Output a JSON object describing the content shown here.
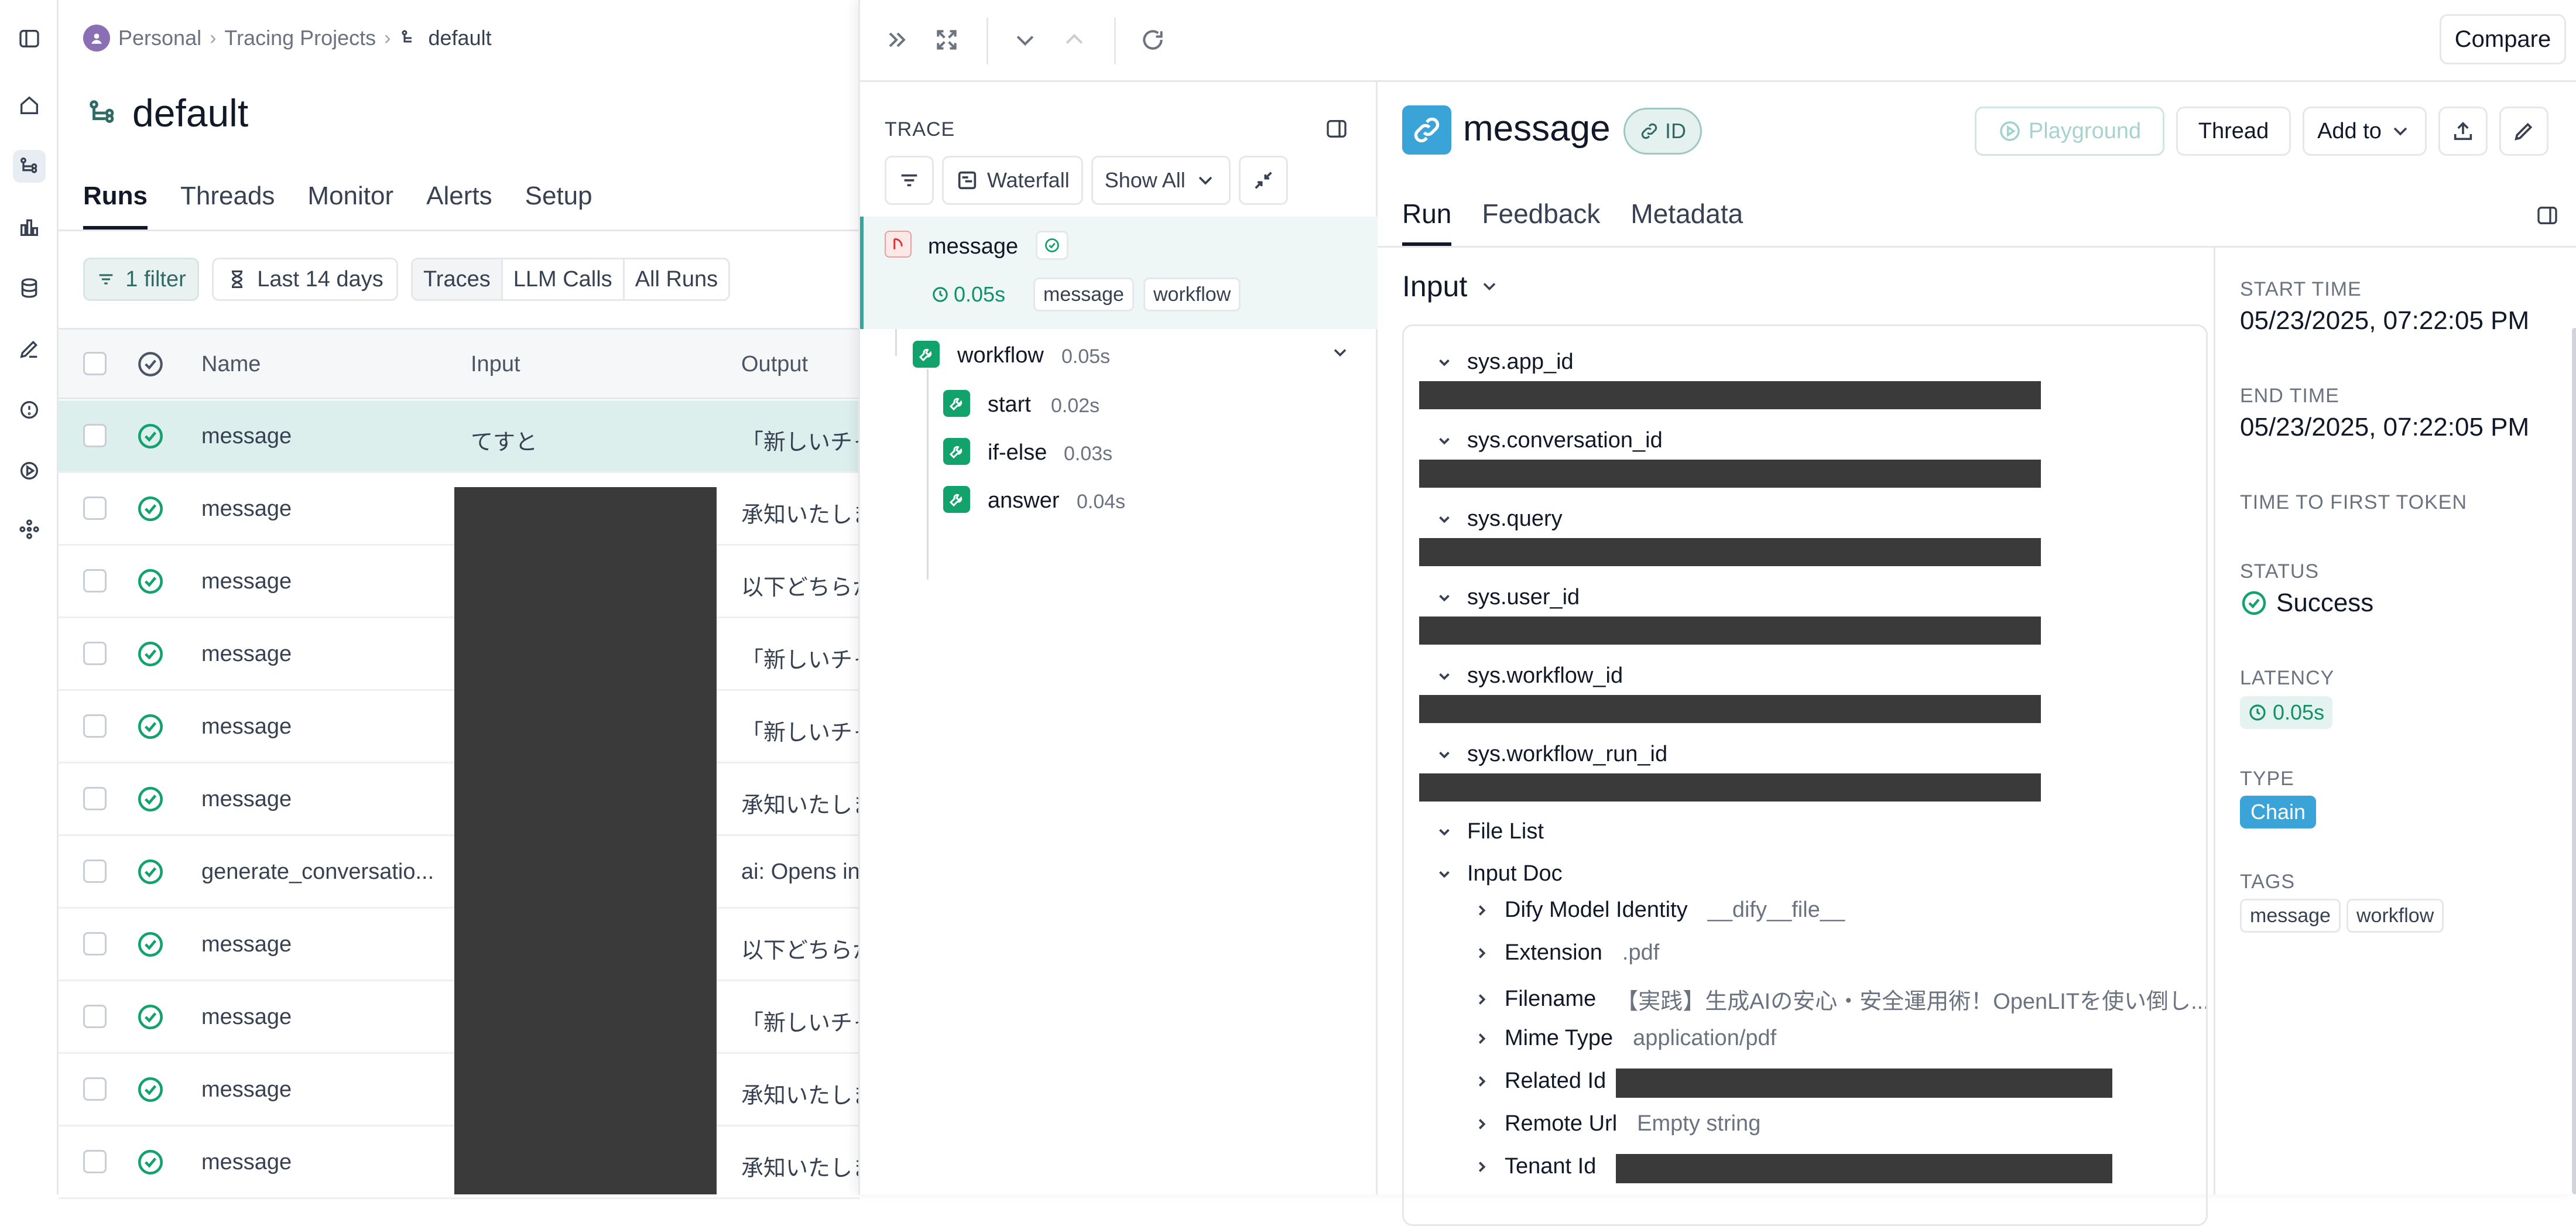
{
  "colors": {
    "accent": "#3aa39a",
    "success": "#12a36c",
    "chain": "#3aa3d8"
  },
  "breadcrumb": [
    "Personal",
    "Tracing Projects",
    "default"
  ],
  "project": {
    "title": "default"
  },
  "tabs": [
    "Runs",
    "Threads",
    "Monitor",
    "Alerts",
    "Setup"
  ],
  "filters": {
    "filter": "1 filter",
    "range": "Last 14 days",
    "types": [
      "Traces",
      "LLM Calls",
      "All Runs"
    ]
  },
  "table": {
    "headers": {
      "name": "Name",
      "input": "Input",
      "output": "Output"
    },
    "rows": [
      {
        "name": "message",
        "input": "てすと",
        "output": "「新しいチャ"
      },
      {
        "name": "message",
        "input": "",
        "output": "承知いたしま"
      },
      {
        "name": "message",
        "input": "",
        "output": "以下どちらか"
      },
      {
        "name": "message",
        "input": "",
        "output": "「新しいチャ"
      },
      {
        "name": "message",
        "input": "",
        "output": "「新しいチャ"
      },
      {
        "name": "message",
        "input": "",
        "output": "承知いたしま"
      },
      {
        "name": "generate_conversatio...",
        "input": "",
        "output": "ai: Opens in"
      },
      {
        "name": "message",
        "input": "",
        "output": "以下どちらか"
      },
      {
        "name": "message",
        "input": "",
        "output": "「新しいチャ"
      },
      {
        "name": "message",
        "input": "",
        "output": "承知いたしま"
      },
      {
        "name": "message",
        "input": "",
        "output": "承知いたしま"
      }
    ]
  },
  "topbar": {
    "compare": "Compare"
  },
  "trace": {
    "label": "TRACE",
    "waterfall": "Waterfall",
    "show_all": "Show All",
    "root": {
      "name": "message",
      "duration": "0.05s",
      "tags": [
        "message",
        "workflow"
      ]
    },
    "workflow": {
      "name": "workflow",
      "duration": "0.05s"
    },
    "children": [
      {
        "name": "start",
        "duration": "0.02s"
      },
      {
        "name": "if-else",
        "duration": "0.03s"
      },
      {
        "name": "answer",
        "duration": "0.04s"
      }
    ]
  },
  "run": {
    "title": "message",
    "id_label": "ID",
    "actions": {
      "playground": "Playground",
      "thread": "Thread",
      "add_to": "Add to"
    },
    "tabs": [
      "Run",
      "Feedback",
      "Metadata"
    ],
    "input_title": "Input",
    "input_keys": [
      "sys.app_id",
      "sys.conversation_id",
      "sys.query",
      "sys.user_id",
      "sys.workflow_id",
      "sys.workflow_run_id"
    ],
    "file_list": "File List",
    "input_doc": "Input Doc",
    "doc_fields": [
      {
        "key": "Dify Model Identity",
        "value": "__dify__file__"
      },
      {
        "key": "Extension",
        "value": ".pdf"
      },
      {
        "key": "Filename",
        "value": "【実践】生成AIの安心・安全運用術！OpenLITを使い倒し..."
      },
      {
        "key": "Mime Type",
        "value": "application/pdf"
      },
      {
        "key": "Related Id",
        "value": ""
      },
      {
        "key": "Remote Url",
        "value": "Empty string"
      },
      {
        "key": "Tenant Id",
        "value": ""
      }
    ]
  },
  "meta": {
    "start_label": "START TIME",
    "start": "05/23/2025, 07:22:05 PM",
    "end_label": "END TIME",
    "end": "05/23/2025, 07:22:05 PM",
    "ttft_label": "TIME TO FIRST TOKEN",
    "status_label": "STATUS",
    "status": "Success",
    "latency_label": "LATENCY",
    "latency": "0.05s",
    "type_label": "TYPE",
    "type": "Chain",
    "tags_label": "TAGS",
    "tags": [
      "message",
      "workflow"
    ]
  }
}
